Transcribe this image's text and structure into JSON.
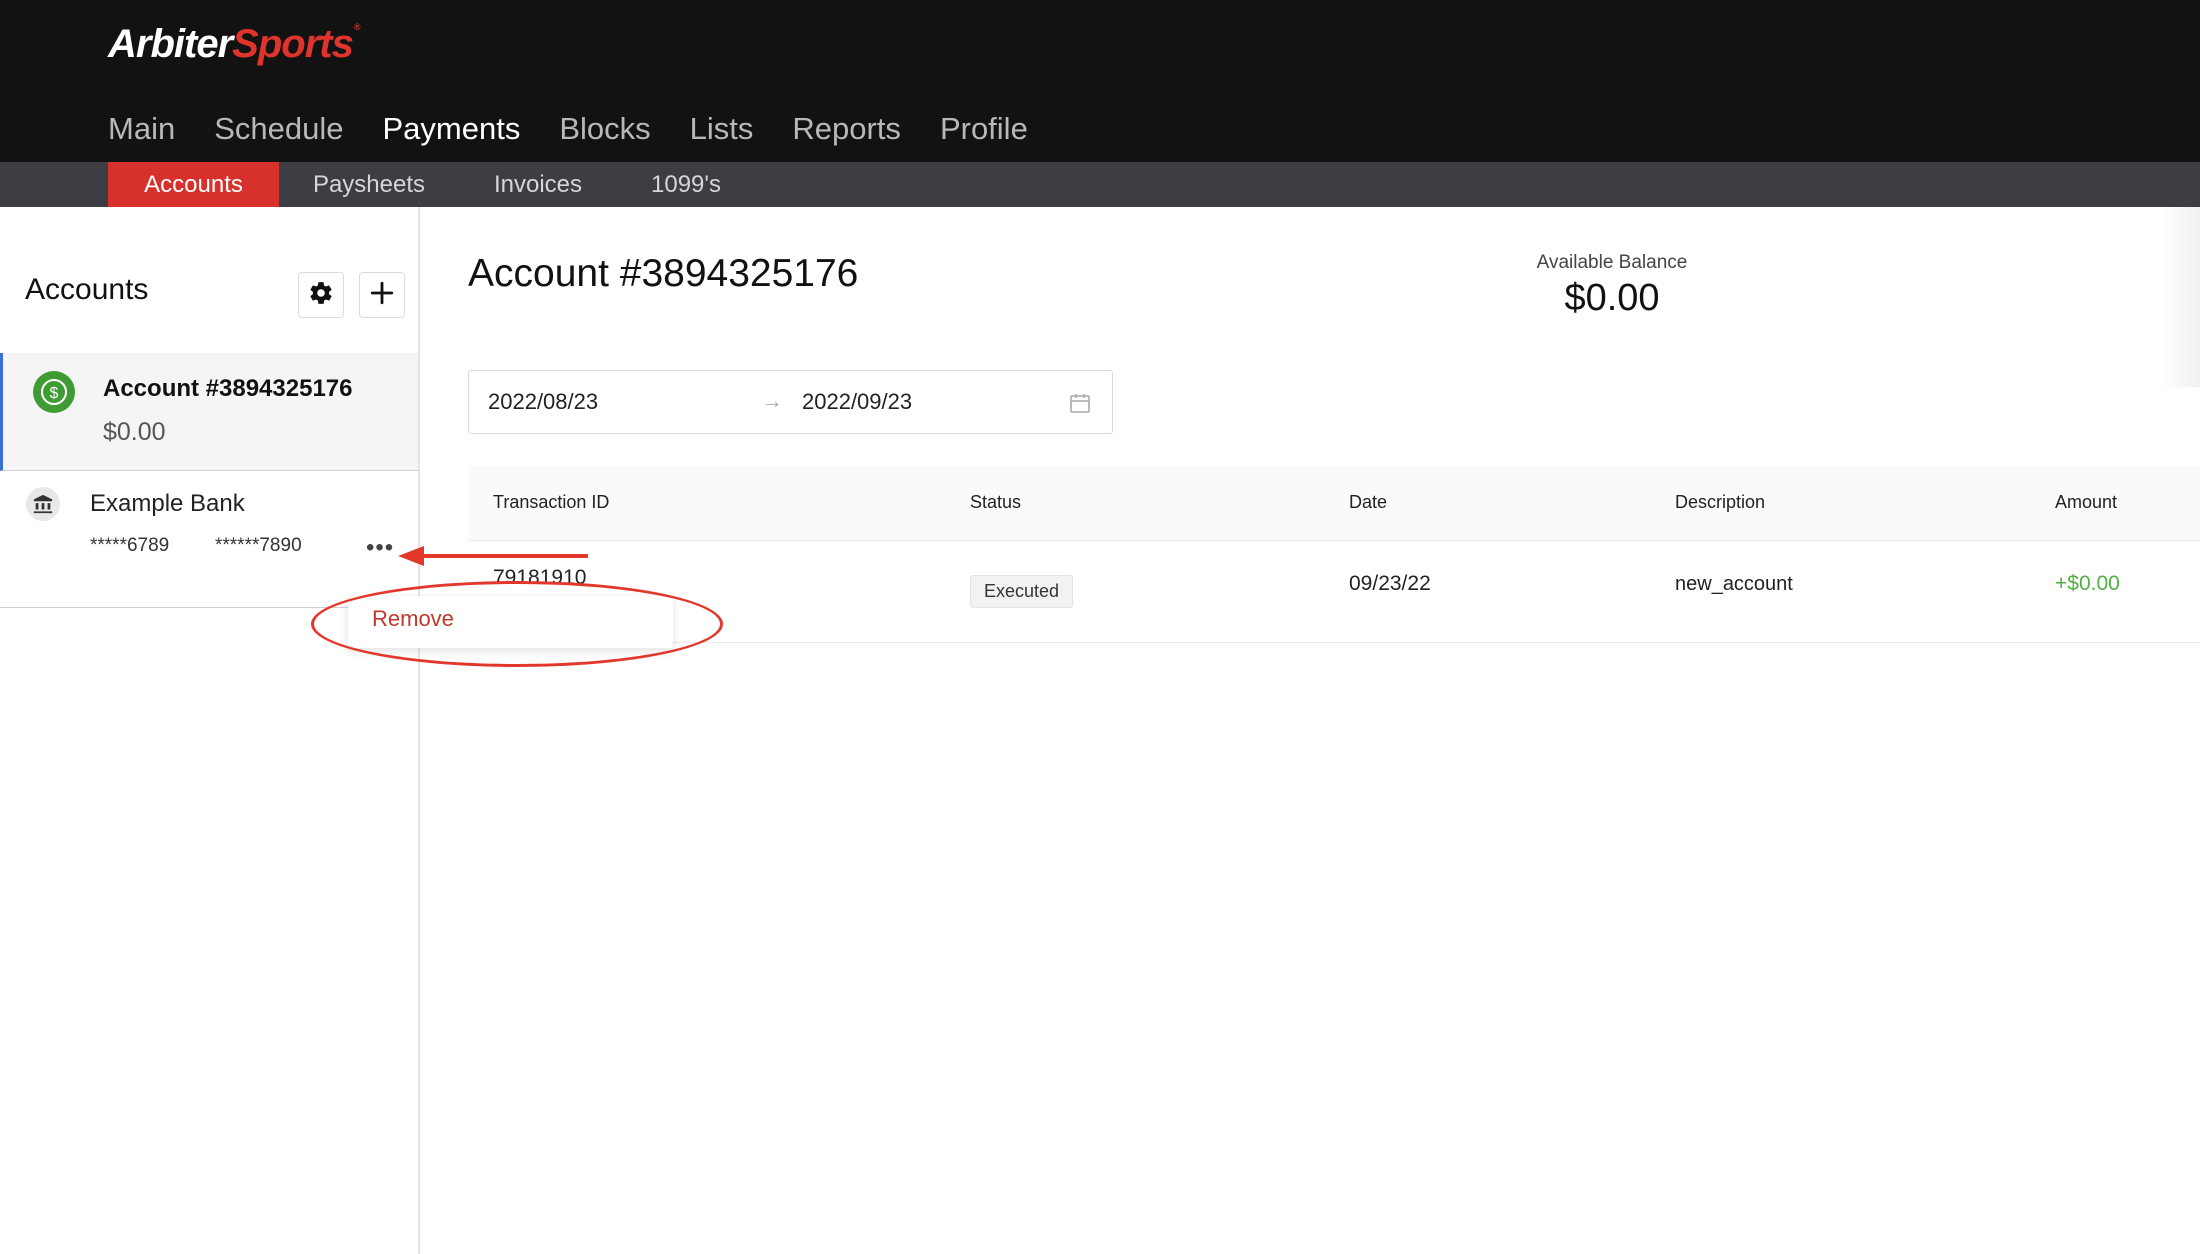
{
  "brand": {
    "part1": "Arbiter",
    "part2": "Sports",
    "tm": "®"
  },
  "main_nav": [
    {
      "label": "Main",
      "active": false
    },
    {
      "label": "Schedule",
      "active": false
    },
    {
      "label": "Payments",
      "active": true
    },
    {
      "label": "Blocks",
      "active": false
    },
    {
      "label": "Lists",
      "active": false
    },
    {
      "label": "Reports",
      "active": false
    },
    {
      "label": "Profile",
      "active": false
    }
  ],
  "sub_nav": [
    {
      "label": "Accounts",
      "active": true
    },
    {
      "label": "Paysheets",
      "active": false
    },
    {
      "label": "Invoices",
      "active": false
    },
    {
      "label": "1099's",
      "active": false
    }
  ],
  "sidebar": {
    "title": "Accounts",
    "settings_icon": "gear-icon",
    "add_icon": "plus-icon",
    "account": {
      "name": "Account #3894325176",
      "balance": "$0.00",
      "icon": "dollar-circle-icon"
    },
    "bank": {
      "name": "Example Bank",
      "account_number": "*****6789",
      "routing_number": "******7890",
      "icon": "bank-icon",
      "more_icon": "ellipsis-icon"
    }
  },
  "dropdown": {
    "remove_label": "Remove"
  },
  "main": {
    "title": "Account #3894325176",
    "balance_label": "Available Balance",
    "balance_value": "$0.00",
    "date_range": {
      "start": "2022/08/23",
      "separator": "→",
      "end": "2022/09/23",
      "icon": "calendar-icon"
    },
    "table": {
      "headers": [
        "Transaction ID",
        "Status",
        "Date",
        "Description",
        "Amount"
      ],
      "rows": [
        {
          "transaction_id": "79181910",
          "status": "Executed",
          "date": "09/23/22",
          "description": "new_account",
          "amount": "+$0.00"
        }
      ]
    }
  },
  "colors": {
    "topbar": "#121212",
    "subnav": "#3c3e44",
    "accent_red": "#d8302a",
    "amount_green": "#52b043",
    "account_icon_green": "#3f9c35",
    "annotation_red": "#e2382c"
  }
}
